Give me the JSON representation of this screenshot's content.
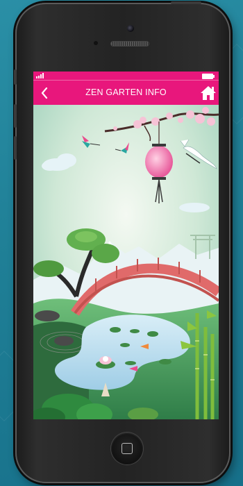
{
  "app": {
    "title": "ZEN GARTEN INFO"
  },
  "colors": {
    "accent": "#e8177c",
    "background": "#1f7f96"
  },
  "navbar": {
    "back_icon": "chevron-left-icon",
    "home_icon": "home-icon"
  },
  "status_bar": {
    "signal_icon": "signal-icon",
    "battery_icon": "battery-icon"
  },
  "content": {
    "illustration": "zen-garden-illustration"
  }
}
